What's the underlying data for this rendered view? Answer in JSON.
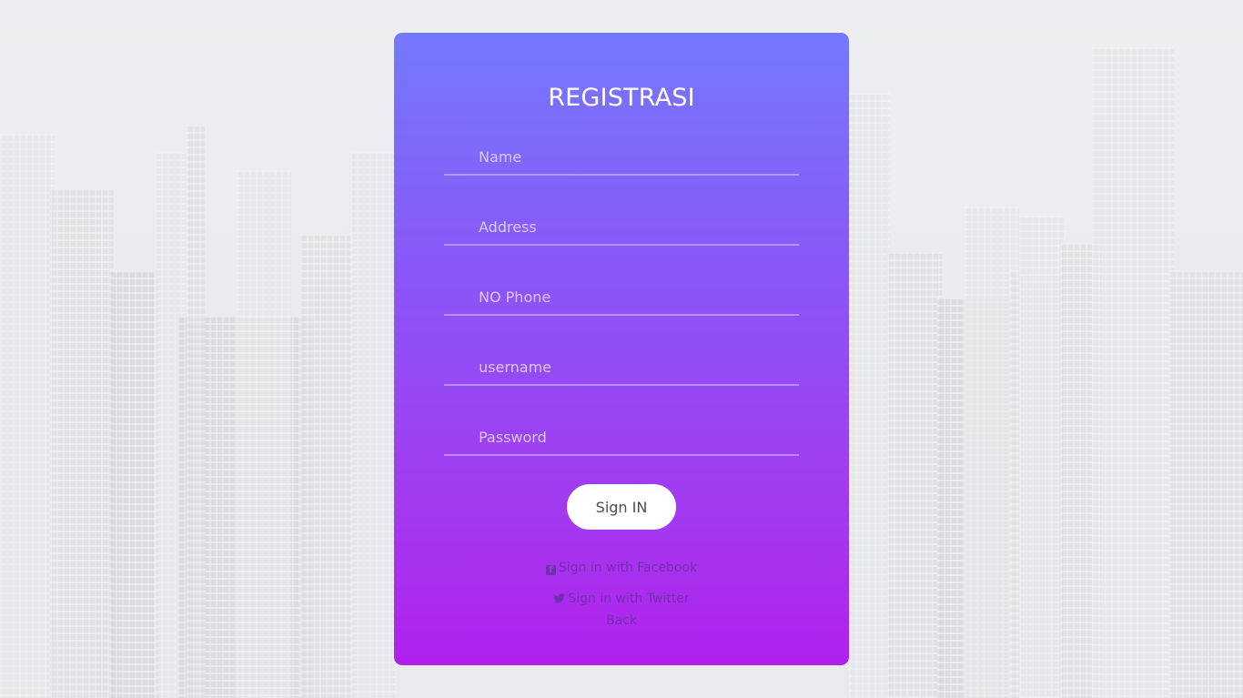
{
  "form": {
    "title": "REGISTRASI",
    "fields": [
      {
        "placeholder": "Name",
        "value": ""
      },
      {
        "placeholder": "Address",
        "value": ""
      },
      {
        "placeholder": "NO Phone",
        "value": ""
      },
      {
        "placeholder": "username",
        "value": ""
      },
      {
        "placeholder": "Password",
        "value": ""
      }
    ],
    "submit_label": "Sign IN",
    "links": {
      "facebook": "Sign in with Facebook",
      "twitter": "Sign in with Twitter",
      "back": "Back"
    }
  },
  "icons": {
    "facebook": "facebook-square-icon",
    "twitter": "twitter-bird-icon"
  },
  "colors": {
    "card_gradient_top": "#7479fd",
    "card_gradient_bottom": "#b021ec",
    "button_bg": "#ffffff",
    "page_bg": "#eceef0"
  }
}
